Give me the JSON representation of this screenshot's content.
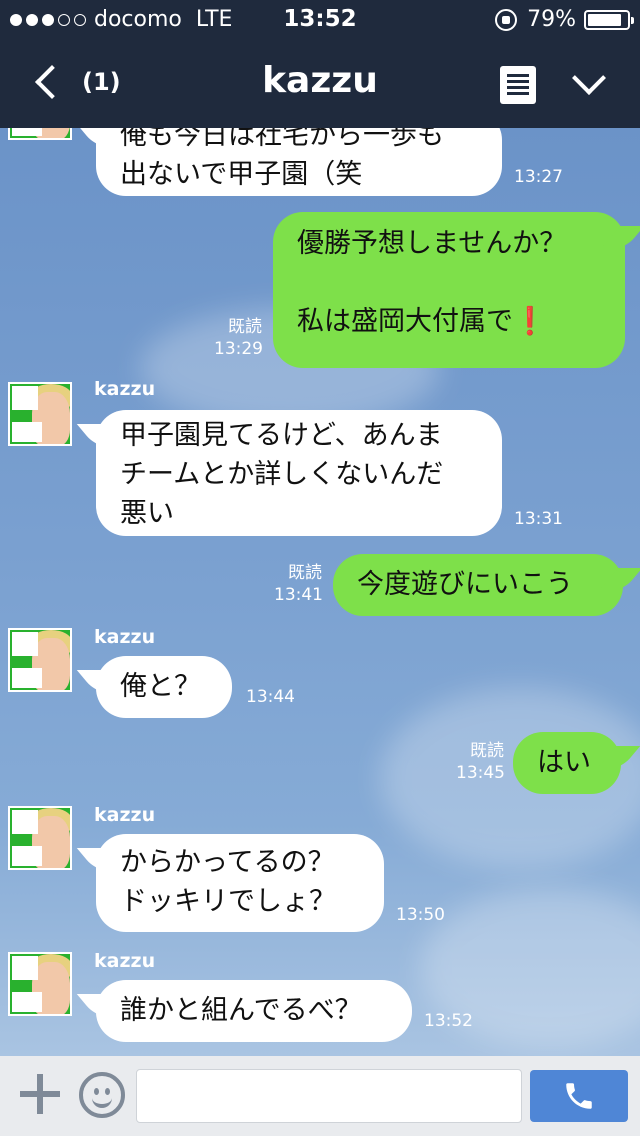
{
  "status_bar": {
    "carrier": "docomo",
    "network": "LTE",
    "time": "13:52",
    "battery": "79%",
    "battery_level": 0.79,
    "signal_bars_filled": 3,
    "signal_bars_total": 5
  },
  "nav": {
    "unread_count": "(1)",
    "title": "kazzu",
    "icons": [
      "back-chevron-icon",
      "notes-icon",
      "chevron-down-icon"
    ]
  },
  "messages": [
    {
      "direction": "in",
      "text": "俺も今日は社宅から一歩も\n出ないで甲子園（笑",
      "time": "13:27"
    },
    {
      "direction": "out",
      "text": "優勝予想しませんか？\n\n私は盛岡大付属で❗",
      "read": "既読",
      "time": "13:29"
    },
    {
      "direction": "in",
      "sender": "kazzu",
      "text": "甲子園見てるけど、あんま\nチームとか詳しくないんだ\n悪い",
      "time": "13:31"
    },
    {
      "direction": "out",
      "text": "今度遊びにいこう",
      "read": "既読",
      "time": "13:41"
    },
    {
      "direction": "in",
      "sender": "kazzu",
      "text": "俺と？",
      "time": "13:44"
    },
    {
      "direction": "out",
      "text": "はい",
      "read": "既読",
      "time": "13:45"
    },
    {
      "direction": "in",
      "sender": "kazzu",
      "text": "からかってるの？\nドッキリでしょ？",
      "time": "13:50"
    },
    {
      "direction": "in",
      "sender": "kazzu",
      "text": "誰かと組んでるべ？",
      "time": "13:52"
    }
  ],
  "input_bar": {
    "text_value": "",
    "icons": [
      "plus-icon",
      "smiley-icon",
      "phone-icon"
    ]
  },
  "colors": {
    "nav_bg": "#1f2a3d",
    "outgoing_bubble": "#7ee04a",
    "incoming_bubble": "#ffffff",
    "call_button": "#4f86d6"
  }
}
